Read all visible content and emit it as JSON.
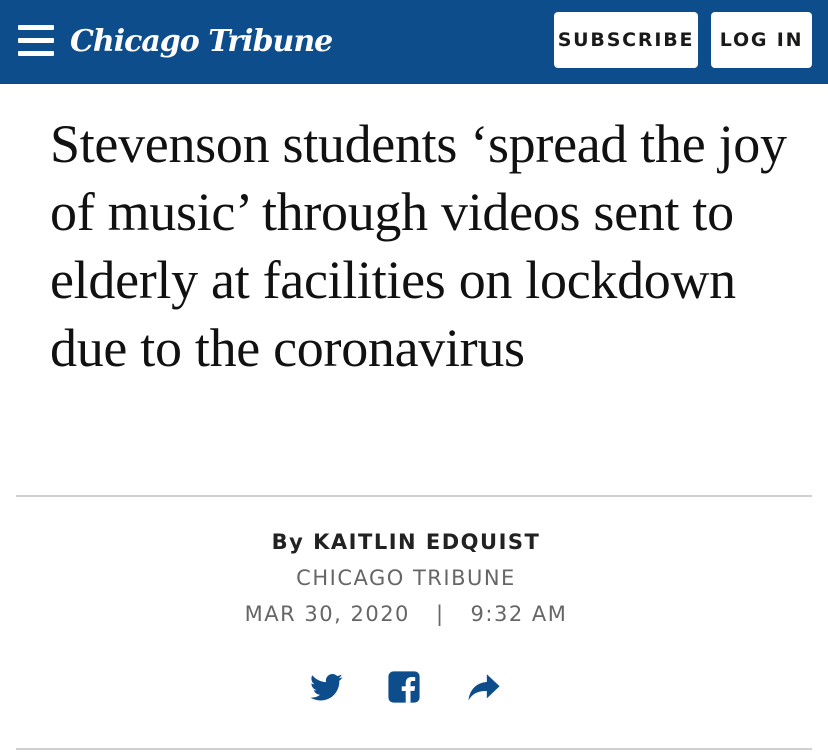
{
  "header": {
    "logo_text": "Chicago Tribune",
    "subscribe_label": "SUBSCRIBE",
    "login_label": "LOG IN",
    "bar_color": "#0e4d8c",
    "menu_icon": "hamburger-menu-icon"
  },
  "article": {
    "headline": "Stevenson students ‘spread the joy of music’ through videos sent to elderly at facilities on lockdown due to the coronavirus",
    "byline_prefix": "By",
    "author": "KAITLIN EDQUIST",
    "source": "CHICAGO TRIBUNE",
    "date": "MAR 30, 2020",
    "separator": "|",
    "time": "9:32 AM"
  },
  "share": {
    "icons": [
      "twitter-icon",
      "facebook-icon",
      "share-forward-icon"
    ],
    "icon_color": "#0e4d8c"
  }
}
